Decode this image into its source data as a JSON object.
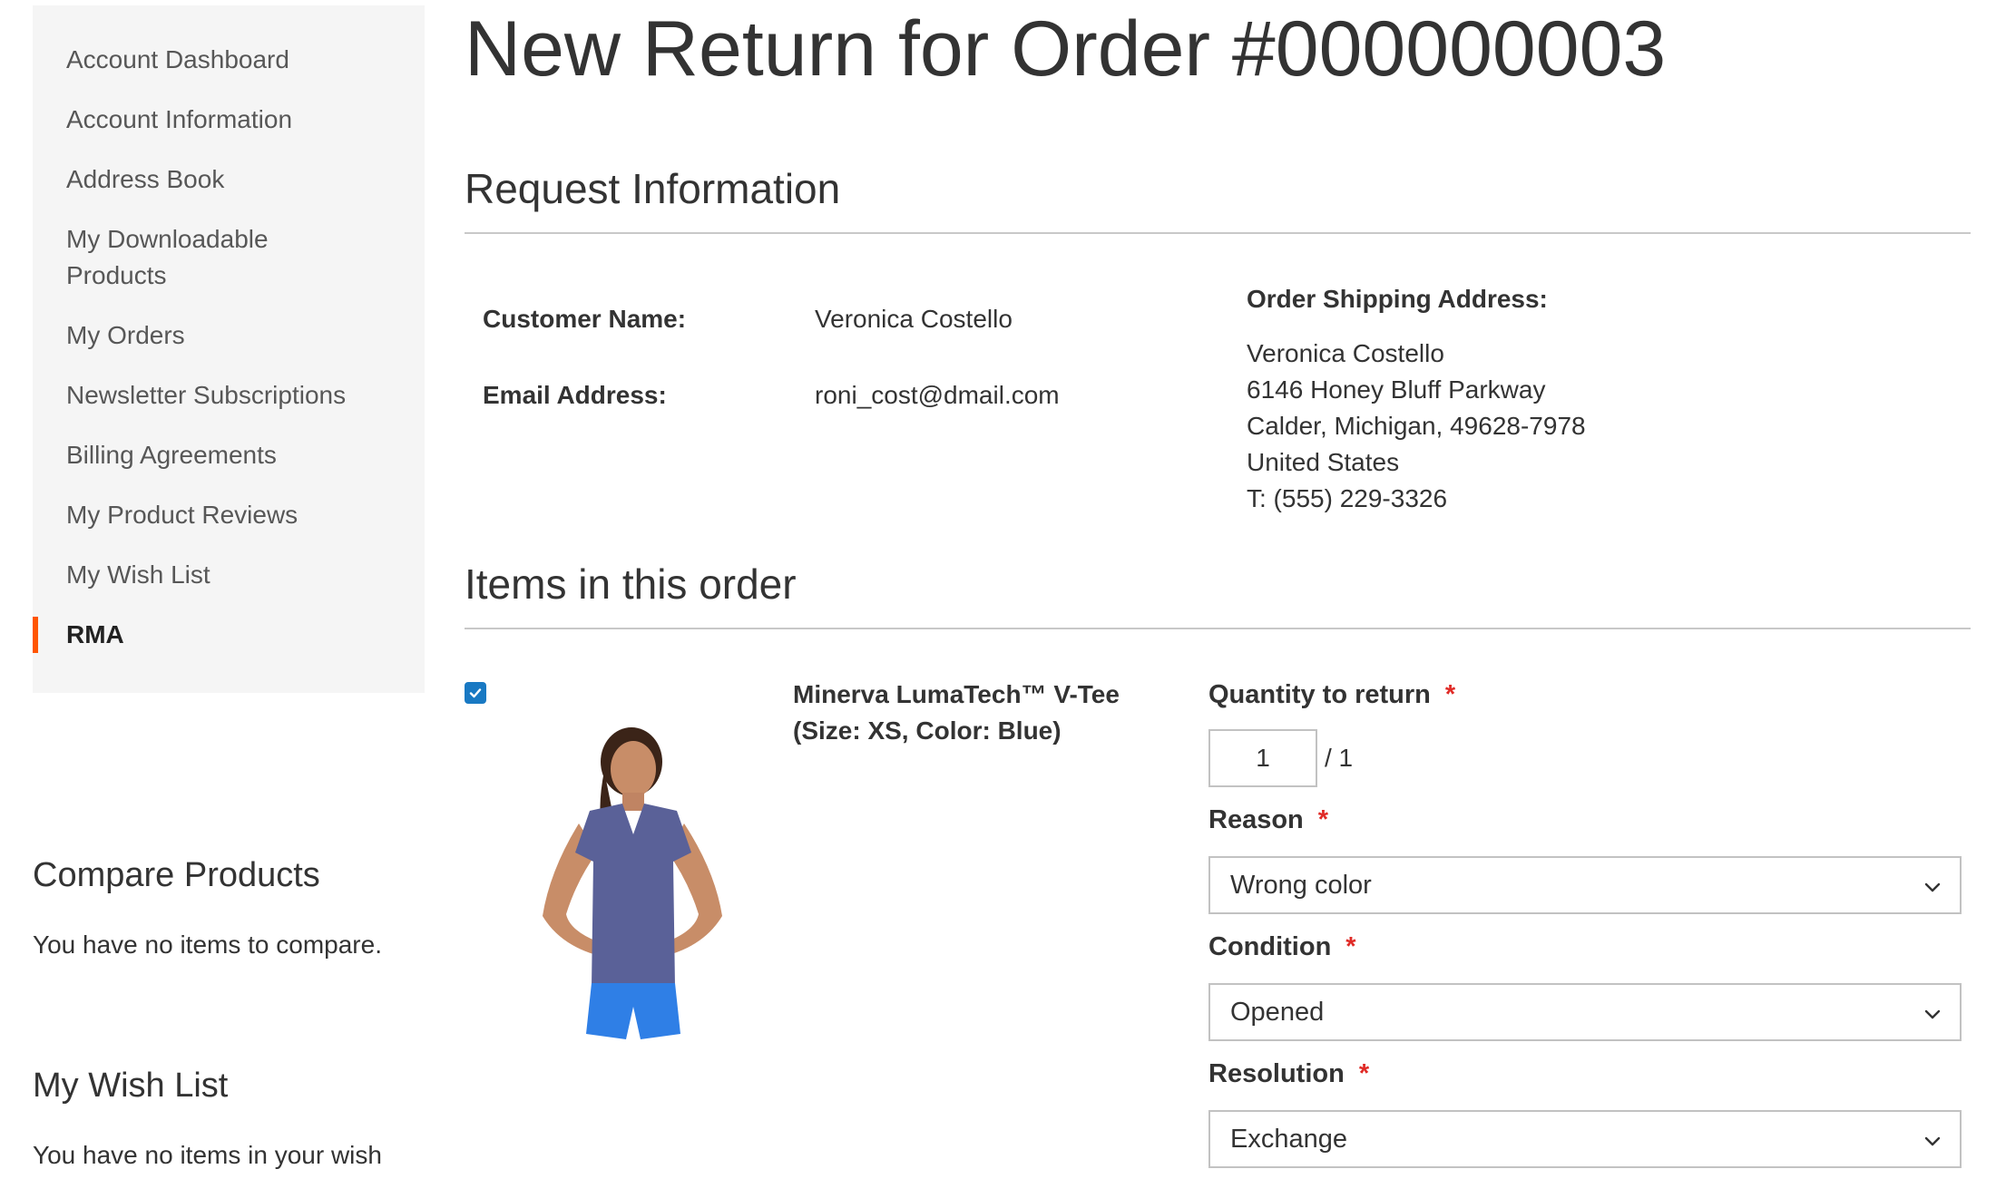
{
  "sidebar": {
    "items": [
      {
        "label": "Account Dashboard"
      },
      {
        "label": "Account Information"
      },
      {
        "label": "Address Book"
      },
      {
        "label": "My Downloadable Products"
      },
      {
        "label": "My Orders"
      },
      {
        "label": "Newsletter Subscriptions"
      },
      {
        "label": "Billing Agreements"
      },
      {
        "label": "My Product Reviews"
      },
      {
        "label": "My Wish List"
      },
      {
        "label": "RMA"
      }
    ],
    "active_item": "RMA",
    "accent_color": "#ff5501"
  },
  "compare": {
    "title": "Compare Products",
    "empty_text": "You have no items to compare."
  },
  "wishlist": {
    "title": "My Wish List",
    "empty_text": "You have no items in your wish"
  },
  "page": {
    "title": "New Return for Order #000000003"
  },
  "request_info": {
    "title": "Request Information",
    "customer_name_label": "Customer Name:",
    "customer_name": "Veronica Costello",
    "email_label": "Email Address:",
    "email": "roni_cost@dmail.com",
    "shipping_label": "Order Shipping Address:",
    "shipping_address": [
      "Veronica Costello",
      "6146 Honey Bluff Parkway",
      "Calder, Michigan, 49628-7978",
      "United States",
      "T: (555) 229-3326"
    ]
  },
  "items": {
    "title": "Items in this order",
    "product": {
      "name_line1": "Minerva LumaTech™ V-Tee",
      "name_line2": "(Size: XS, Color: Blue)",
      "checked": true,
      "checkbox_color": "#1979c3"
    },
    "quantity": {
      "label": "Quantity to return",
      "required_mark": "*",
      "value": "1",
      "total": "/ 1"
    },
    "reason": {
      "label": "Reason",
      "required_mark": "*",
      "selected": "Wrong color"
    },
    "condition": {
      "label": "Condition",
      "required_mark": "*",
      "selected": "Opened"
    },
    "resolution": {
      "label": "Resolution",
      "required_mark": "*",
      "selected": "Exchange"
    }
  }
}
